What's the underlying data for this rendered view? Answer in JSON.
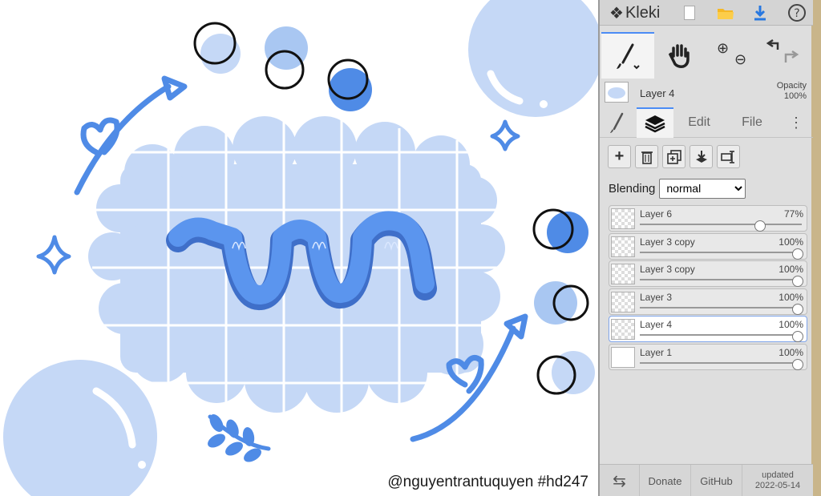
{
  "app": {
    "name": "Kleki",
    "updated_label": "updated",
    "updated_date": "2022-05-14"
  },
  "icons": {
    "logo": "kleki-logo-icon",
    "new": "new-file-icon",
    "open": "folder-icon",
    "save": "download-icon",
    "help": "help-icon",
    "brush": "brush-icon",
    "hand": "hand-icon",
    "zoom_in": "zoom-in-icon",
    "zoom_out": "zoom-out-icon",
    "undo": "undo-icon",
    "redo": "redo-icon"
  },
  "colors": {
    "accent": "#4b8cf5",
    "art_light": "#c5d8f6",
    "art_mid": "#a9c7f2",
    "art_blue": "#4f8be6"
  },
  "current_layer": {
    "name": "Layer 4",
    "opacity_label": "Opacity",
    "opacity_value": "100%"
  },
  "tabs": [
    {
      "label": "brush-tab",
      "text": ""
    },
    {
      "label": "layers-tab",
      "text": ""
    },
    {
      "label": "edit-tab",
      "text": "Edit"
    },
    {
      "label": "file-tab",
      "text": "File"
    }
  ],
  "blending": {
    "label": "Blending",
    "selected": "normal"
  },
  "layers": [
    {
      "name": "Layer 6",
      "opacity": "77%",
      "value": 0.77,
      "selected": false,
      "thumb": "checker"
    },
    {
      "name": "Layer 3 copy",
      "opacity": "100%",
      "value": 1.0,
      "selected": false,
      "thumb": "checker"
    },
    {
      "name": "Layer 3 copy",
      "opacity": "100%",
      "value": 1.0,
      "selected": false,
      "thumb": "checker"
    },
    {
      "name": "Layer 3",
      "opacity": "100%",
      "value": 1.0,
      "selected": false,
      "thumb": "checker"
    },
    {
      "name": "Layer 4",
      "opacity": "100%",
      "value": 1.0,
      "selected": true,
      "thumb": "checker"
    },
    {
      "name": "Layer 1",
      "opacity": "100%",
      "value": 1.0,
      "selected": false,
      "thumb": "white"
    }
  ],
  "bottom": {
    "donate": "Donate",
    "github": "GitHub"
  },
  "canvas": {
    "watermark": "@nguyentrantuquyen  #hd247"
  }
}
